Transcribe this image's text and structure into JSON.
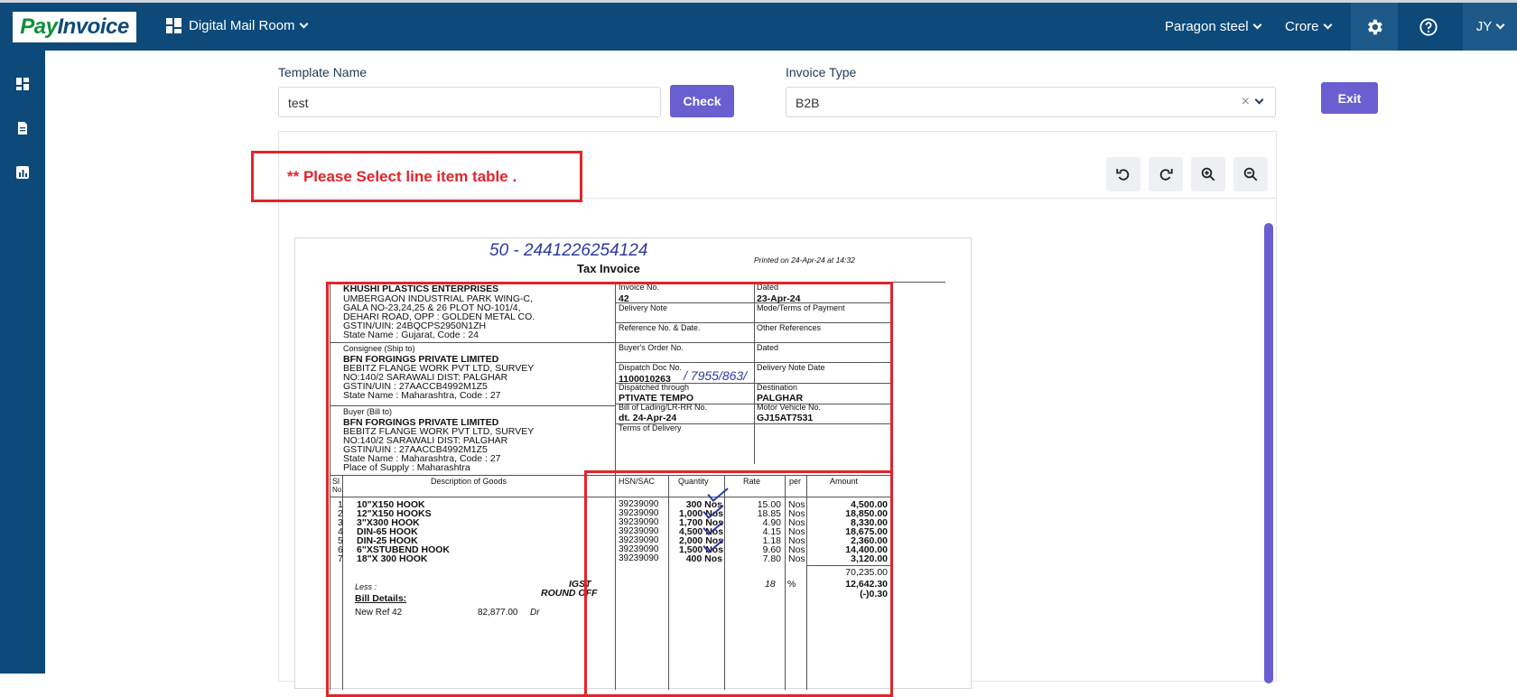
{
  "header": {
    "logo_pay": "Pay",
    "logo_invoice": "Invoice",
    "module": "Digital Mail Room",
    "company": "Paragon steel",
    "unit": "Crore",
    "user_initials": "JY"
  },
  "form": {
    "template_name_label": "Template Name",
    "template_name_value": "test",
    "check_label": "Check",
    "invoice_type_label": "Invoice Type",
    "invoice_type_value": "B2B",
    "clear_symbol": "×",
    "exit_label": "Exit"
  },
  "warning": "** Please Select line item table .",
  "document": {
    "hand_top": "50 - 2441226254124",
    "title": "Tax Invoice",
    "printed_on": "Printed on 24-Apr-24 at 14:32",
    "seller": [
      "KHUSHI PLASTICS ENTERPRISES",
      "UMBERGAON INDUSTRIAL PARK WING-C,",
      "GALA NO-23,24,25 & 26 PLOT NO-101/4,",
      "DEHARI ROAD, OPP : GOLDEN METAL CO.",
      "GSTIN/UIN: 24BQCPS2950N1ZH",
      "State Name :  Gujarat, Code : 24"
    ],
    "consignee_label": "Consignee (Ship to)",
    "consignee": [
      "BFN FORGINGS PRIVATE LIMITED",
      "BEBITZ FLANGE WORK PVT LTD, SURVEY",
      "NO:140/2 SARAWALI  DIST: PALGHAR",
      "GSTIN/UIN        :  27AACCB4992M1Z5",
      "State Name       :  Maharashtra, Code : 27"
    ],
    "buyer_label": "Buyer (Bill to)",
    "buyer": [
      "BFN FORGINGS PRIVATE LIMITED",
      "BEBITZ FLANGE WORK PVT LTD, SURVEY",
      "NO:140/2 SARAWALI  DIST: PALGHAR",
      "GSTIN/UIN        :  27AACCB4992M1Z5",
      "State Name       :  Maharashtra, Code : 27",
      "Place of Supply  :  Maharashtra"
    ],
    "invoice_no_label": "Invoice No.",
    "invoice_no": "42",
    "dated_label": "Dated",
    "dated": "23-Apr-24",
    "delivery_note_label": "Delivery Note",
    "mode_terms_label": "Mode/Terms of Payment",
    "reference_label": "Reference No. & Date.",
    "other_ref_label": "Other References",
    "buyers_order_label": "Buyer's Order No.",
    "dated2_label": "Dated",
    "dispatch_doc_label": "Dispatch Doc No.",
    "dispatch_doc": "1100010263",
    "dispatch_hand": "/ 7955/863/",
    "delivery_note_date_label": "Delivery Note Date",
    "dispatched_through_label": "Dispatched through",
    "dispatched_through": "PTIVATE TEMPO",
    "destination_label": "Destination",
    "destination": "PALGHAR",
    "bill_lading_label": "Bill of Lading/LR-RR No.",
    "bill_lading": "dt. 24-Apr-24",
    "vehicle_label": "Motor Vehicle No.",
    "vehicle": "GJ15AT7531",
    "terms_label": "Terms of Delivery",
    "col_sl": "Sl",
    "col_no": "No.",
    "col_desc": "Description of Goods",
    "col_hsn": "HSN/SAC",
    "col_qty": "Quantity",
    "col_rate": "Rate",
    "col_per": "per",
    "col_amount": "Amount",
    "items": [
      {
        "sl": "1",
        "desc": "10\"X150 HOOK",
        "hsn": "39239090",
        "qty": "300 Nos",
        "rate": "15.00",
        "per": "Nos",
        "amount": "4,500.00"
      },
      {
        "sl": "2",
        "desc": "12\"X150 HOOKS",
        "hsn": "39239090",
        "qty": "1,000 Nos",
        "rate": "18.85",
        "per": "Nos",
        "amount": "18,850.00"
      },
      {
        "sl": "3",
        "desc": "3\"X300 HOOK",
        "hsn": "39239090",
        "qty": "1,700 Nos",
        "rate": "4.90",
        "per": "Nos",
        "amount": "8,330.00"
      },
      {
        "sl": "4",
        "desc": "DIN-65 HOOK",
        "hsn": "39239090",
        "qty": "4,500 Nos",
        "rate": "4.15",
        "per": "Nos",
        "amount": "18,675.00"
      },
      {
        "sl": "5",
        "desc": "DIN-25 HOOK",
        "hsn": "39239090",
        "qty": "2,000 Nos",
        "rate": "1.18",
        "per": "Nos",
        "amount": "2,360.00"
      },
      {
        "sl": "6",
        "desc": "6\"XSTUBEND HOOK",
        "hsn": "39239090",
        "qty": "1,500 Nos",
        "rate": "9.60",
        "per": "Nos",
        "amount": "14,400.00"
      },
      {
        "sl": "7",
        "desc": "18\"X 300 HOOK",
        "hsn": "39239090",
        "qty": "400 Nos",
        "rate": "7.80",
        "per": "Nos",
        "amount": "3,120.00"
      }
    ],
    "subtotal": "70,235.00",
    "igst_label": "IGST",
    "igst_rate": "18",
    "igst_pct": "%",
    "igst_amount": "12,642.30",
    "roundoff_label": "ROUND OFF",
    "roundoff_amount": "(-)0.30",
    "less_label": "Less :",
    "bill_details_label": "Bill Details:",
    "new_ref_label": "New Ref  42",
    "new_ref_amount": "82,877.00",
    "new_ref_dr": "Dr"
  }
}
